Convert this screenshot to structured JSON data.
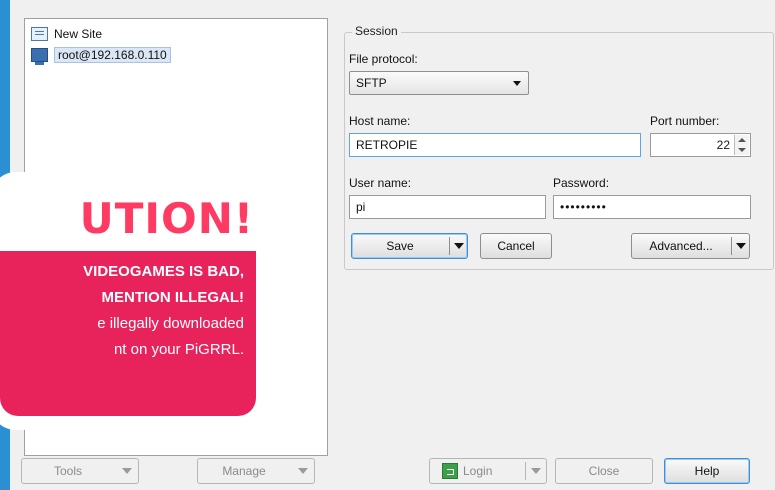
{
  "site_tree": {
    "items": [
      {
        "label": "New Site",
        "icon": "new-site-icon"
      },
      {
        "label": "root@192.168.0.110",
        "icon": "monitor-icon"
      }
    ]
  },
  "session": {
    "legend": "Session",
    "file_protocol_label": "File protocol:",
    "file_protocol_value": "SFTP",
    "host_name_label": "Host name:",
    "host_name_value": "RETROPIE",
    "port_number_label": "Port number:",
    "port_number_value": "22",
    "user_name_label": "User name:",
    "user_name_value": "pi",
    "password_label": "Password:",
    "password_value": "•••••••••",
    "save_label": "Save",
    "cancel_label": "Cancel",
    "advanced_label": "Advanced..."
  },
  "footer": {
    "tools_label": "Tools",
    "manage_label": "Manage",
    "login_label": "Login",
    "close_label": "Close",
    "help_label": "Help"
  },
  "callout": {
    "title": "UTION!",
    "line1": "VIDEOGAMES IS BAD,",
    "line2": "MENTION ILLEGAL!",
    "line3": "e illegally downloaded",
    "line4": "nt on your PiGRRL."
  },
  "colors": {
    "frame_blue": "#2a8fd3",
    "callout_pink": "#e8235c",
    "title_pink": "#ff3b64"
  }
}
